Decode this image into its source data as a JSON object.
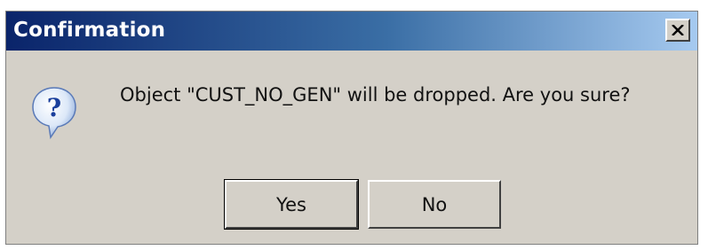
{
  "window": {
    "title": "Confirmation",
    "close_label": "Close"
  },
  "message": {
    "text": "Object \"CUST_NO_GEN\" will be dropped. Are you sure?",
    "icon": "question-icon"
  },
  "buttons": {
    "yes_label": "Yes",
    "no_label": "No",
    "default": "yes"
  },
  "colors": {
    "title_start": "#0a246a",
    "title_end": "#a6caf0",
    "dialog_bg": "#d4d0c8",
    "title_text": "#ffffff"
  }
}
